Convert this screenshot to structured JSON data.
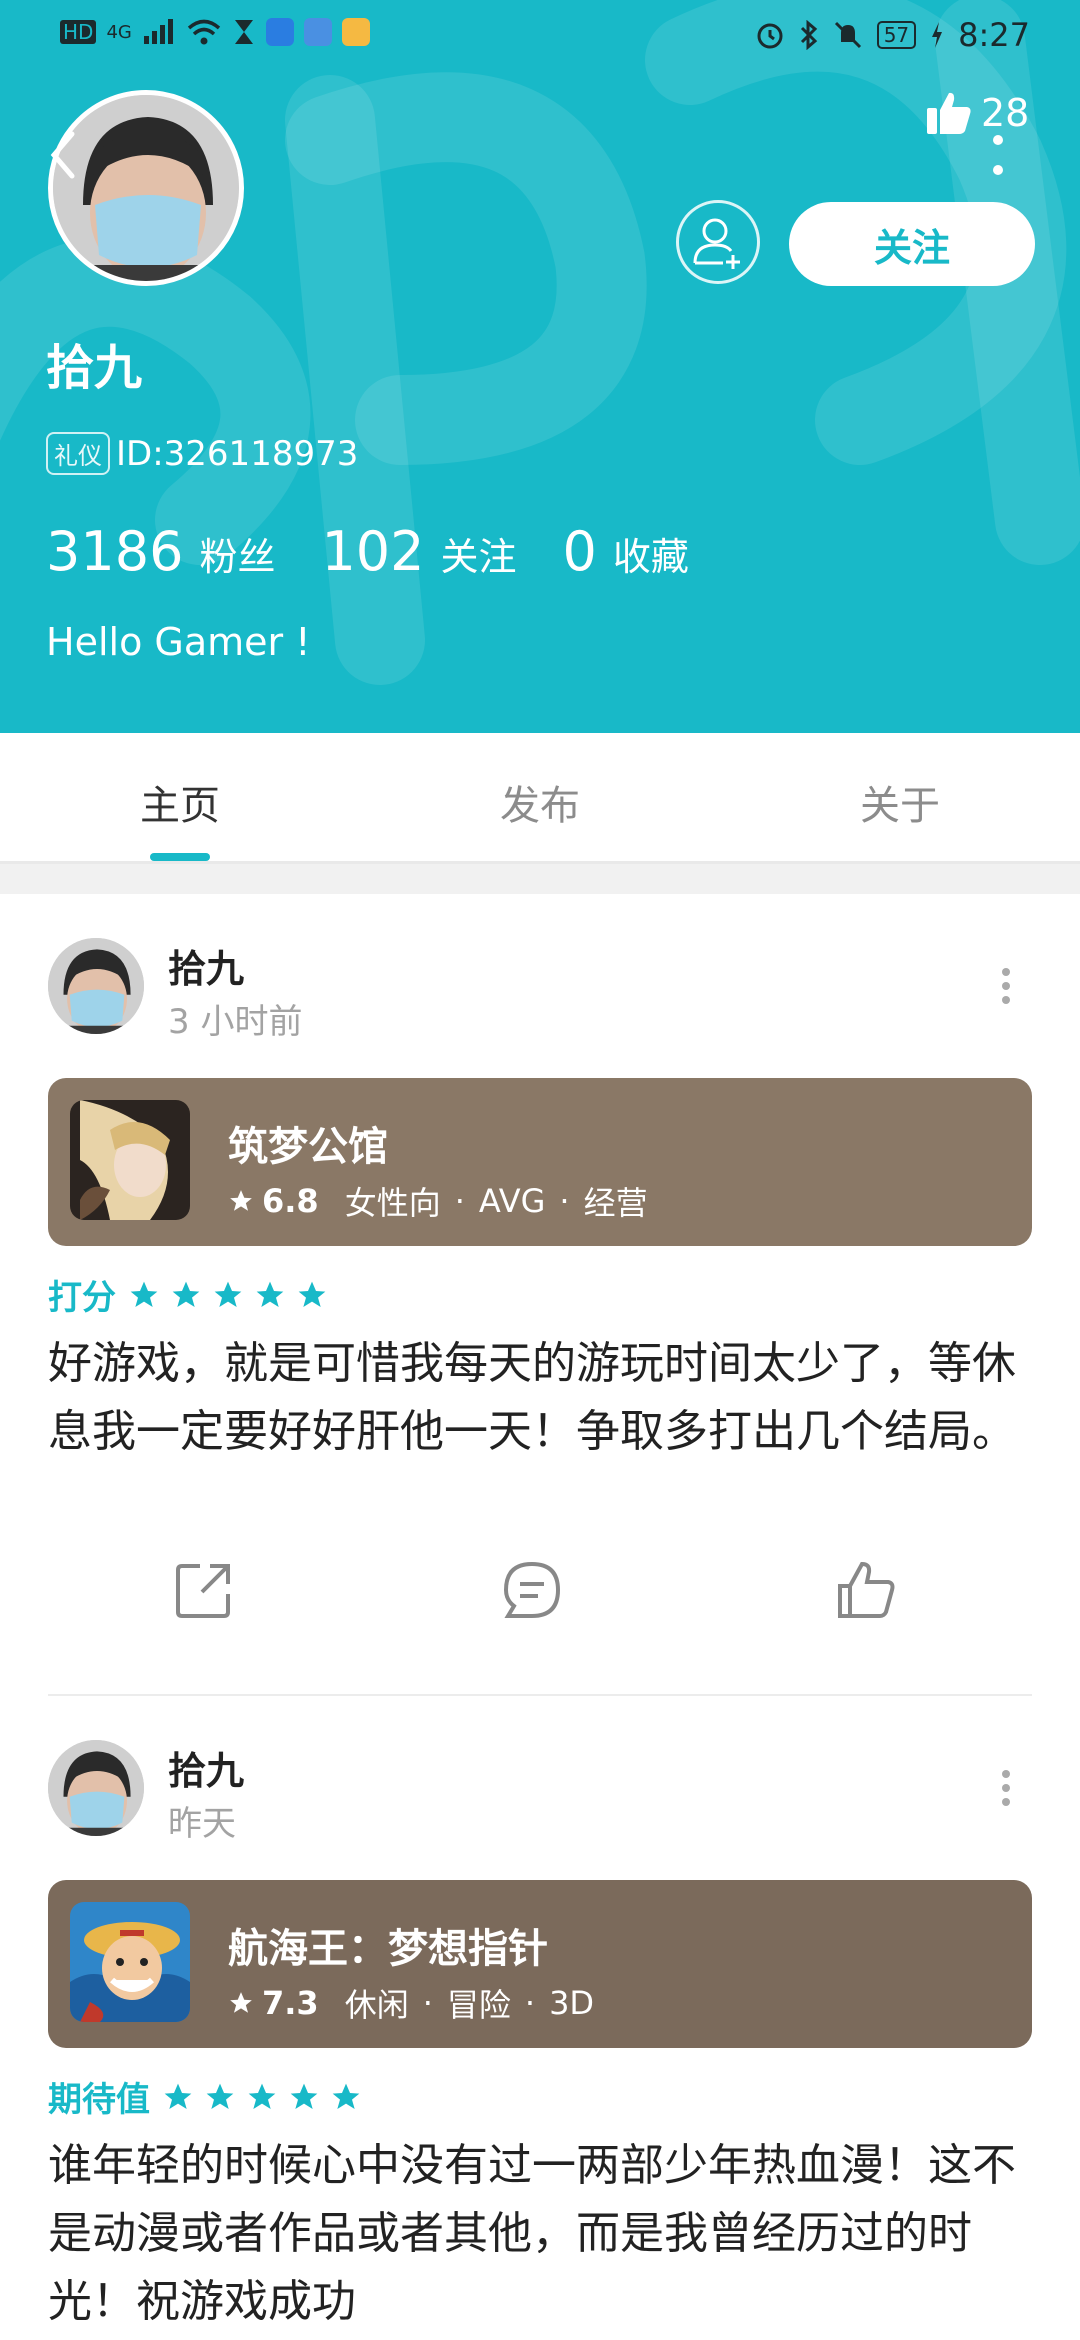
{
  "status_bar": {
    "left_indicators": [
      "HD",
      "4G"
    ],
    "battery": "57",
    "time": "8:27"
  },
  "profile": {
    "name": "拾九",
    "id_tag": "礼仪",
    "id_text": "ID:326118973",
    "likes": "28",
    "follow_label": "关注",
    "stats": [
      {
        "value": "3186",
        "label": "粉丝"
      },
      {
        "value": "102",
        "label": "关注"
      },
      {
        "value": "0",
        "label": "收藏"
      }
    ],
    "bio": "Hello Gamer !"
  },
  "tabs": [
    {
      "label": "主页",
      "active": true
    },
    {
      "label": "发布",
      "active": false
    },
    {
      "label": "关于",
      "active": false
    }
  ],
  "posts": [
    {
      "author": "拾九",
      "time": "3 小时前",
      "game": {
        "title": "筑梦公馆",
        "score": "6.8",
        "tags": [
          "女性向",
          "AVG",
          "经营"
        ],
        "card_color": "#8a7866"
      },
      "rating_label": "打分",
      "stars": 5,
      "text": "好游戏，就是可惜我每天的游玩时间太少了，等休息我一定要好好肝他一天！争取多打出几个结局。"
    },
    {
      "author": "拾九",
      "time": "昨天",
      "game": {
        "title": "航海王：梦想指针",
        "score": "7.3",
        "tags": [
          "休闲",
          "冒险",
          "3D"
        ],
        "card_color": "#7b6a5b"
      },
      "rating_label": "期待值",
      "stars": 5,
      "text": "谁年轻的时候心中没有过一两部少年热血漫！这不是动漫或者作品或者其他，而是我曾经历过的时光！祝游戏成功"
    }
  ],
  "colors": {
    "accent": "#18b9c8",
    "header_bg": "#18b9c8"
  }
}
